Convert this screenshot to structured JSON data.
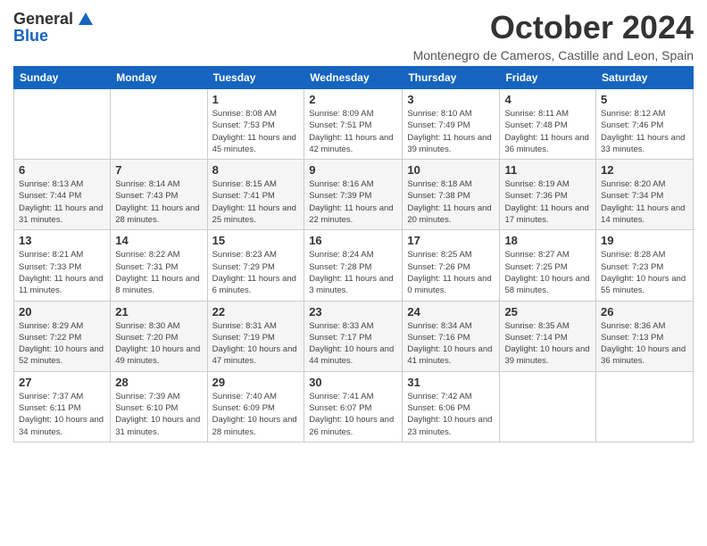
{
  "header": {
    "logo": {
      "general": "General",
      "blue": "Blue"
    },
    "title": "October 2024",
    "location": "Montenegro de Cameros, Castille and Leon, Spain"
  },
  "weekdays": [
    "Sunday",
    "Monday",
    "Tuesday",
    "Wednesday",
    "Thursday",
    "Friday",
    "Saturday"
  ],
  "weeks": [
    [
      {
        "day": "",
        "sunrise": "",
        "sunset": "",
        "daylight": ""
      },
      {
        "day": "",
        "sunrise": "",
        "sunset": "",
        "daylight": ""
      },
      {
        "day": "1",
        "sunrise": "Sunrise: 8:08 AM",
        "sunset": "Sunset: 7:53 PM",
        "daylight": "Daylight: 11 hours and 45 minutes."
      },
      {
        "day": "2",
        "sunrise": "Sunrise: 8:09 AM",
        "sunset": "Sunset: 7:51 PM",
        "daylight": "Daylight: 11 hours and 42 minutes."
      },
      {
        "day": "3",
        "sunrise": "Sunrise: 8:10 AM",
        "sunset": "Sunset: 7:49 PM",
        "daylight": "Daylight: 11 hours and 39 minutes."
      },
      {
        "day": "4",
        "sunrise": "Sunrise: 8:11 AM",
        "sunset": "Sunset: 7:48 PM",
        "daylight": "Daylight: 11 hours and 36 minutes."
      },
      {
        "day": "5",
        "sunrise": "Sunrise: 8:12 AM",
        "sunset": "Sunset: 7:46 PM",
        "daylight": "Daylight: 11 hours and 33 minutes."
      }
    ],
    [
      {
        "day": "6",
        "sunrise": "Sunrise: 8:13 AM",
        "sunset": "Sunset: 7:44 PM",
        "daylight": "Daylight: 11 hours and 31 minutes."
      },
      {
        "day": "7",
        "sunrise": "Sunrise: 8:14 AM",
        "sunset": "Sunset: 7:43 PM",
        "daylight": "Daylight: 11 hours and 28 minutes."
      },
      {
        "day": "8",
        "sunrise": "Sunrise: 8:15 AM",
        "sunset": "Sunset: 7:41 PM",
        "daylight": "Daylight: 11 hours and 25 minutes."
      },
      {
        "day": "9",
        "sunrise": "Sunrise: 8:16 AM",
        "sunset": "Sunset: 7:39 PM",
        "daylight": "Daylight: 11 hours and 22 minutes."
      },
      {
        "day": "10",
        "sunrise": "Sunrise: 8:18 AM",
        "sunset": "Sunset: 7:38 PM",
        "daylight": "Daylight: 11 hours and 20 minutes."
      },
      {
        "day": "11",
        "sunrise": "Sunrise: 8:19 AM",
        "sunset": "Sunset: 7:36 PM",
        "daylight": "Daylight: 11 hours and 17 minutes."
      },
      {
        "day": "12",
        "sunrise": "Sunrise: 8:20 AM",
        "sunset": "Sunset: 7:34 PM",
        "daylight": "Daylight: 11 hours and 14 minutes."
      }
    ],
    [
      {
        "day": "13",
        "sunrise": "Sunrise: 8:21 AM",
        "sunset": "Sunset: 7:33 PM",
        "daylight": "Daylight: 11 hours and 11 minutes."
      },
      {
        "day": "14",
        "sunrise": "Sunrise: 8:22 AM",
        "sunset": "Sunset: 7:31 PM",
        "daylight": "Daylight: 11 hours and 8 minutes."
      },
      {
        "day": "15",
        "sunrise": "Sunrise: 8:23 AM",
        "sunset": "Sunset: 7:29 PM",
        "daylight": "Daylight: 11 hours and 6 minutes."
      },
      {
        "day": "16",
        "sunrise": "Sunrise: 8:24 AM",
        "sunset": "Sunset: 7:28 PM",
        "daylight": "Daylight: 11 hours and 3 minutes."
      },
      {
        "day": "17",
        "sunrise": "Sunrise: 8:25 AM",
        "sunset": "Sunset: 7:26 PM",
        "daylight": "Daylight: 11 hours and 0 minutes."
      },
      {
        "day": "18",
        "sunrise": "Sunrise: 8:27 AM",
        "sunset": "Sunset: 7:25 PM",
        "daylight": "Daylight: 10 hours and 58 minutes."
      },
      {
        "day": "19",
        "sunrise": "Sunrise: 8:28 AM",
        "sunset": "Sunset: 7:23 PM",
        "daylight": "Daylight: 10 hours and 55 minutes."
      }
    ],
    [
      {
        "day": "20",
        "sunrise": "Sunrise: 8:29 AM",
        "sunset": "Sunset: 7:22 PM",
        "daylight": "Daylight: 10 hours and 52 minutes."
      },
      {
        "day": "21",
        "sunrise": "Sunrise: 8:30 AM",
        "sunset": "Sunset: 7:20 PM",
        "daylight": "Daylight: 10 hours and 49 minutes."
      },
      {
        "day": "22",
        "sunrise": "Sunrise: 8:31 AM",
        "sunset": "Sunset: 7:19 PM",
        "daylight": "Daylight: 10 hours and 47 minutes."
      },
      {
        "day": "23",
        "sunrise": "Sunrise: 8:33 AM",
        "sunset": "Sunset: 7:17 PM",
        "daylight": "Daylight: 10 hours and 44 minutes."
      },
      {
        "day": "24",
        "sunrise": "Sunrise: 8:34 AM",
        "sunset": "Sunset: 7:16 PM",
        "daylight": "Daylight: 10 hours and 41 minutes."
      },
      {
        "day": "25",
        "sunrise": "Sunrise: 8:35 AM",
        "sunset": "Sunset: 7:14 PM",
        "daylight": "Daylight: 10 hours and 39 minutes."
      },
      {
        "day": "26",
        "sunrise": "Sunrise: 8:36 AM",
        "sunset": "Sunset: 7:13 PM",
        "daylight": "Daylight: 10 hours and 36 minutes."
      }
    ],
    [
      {
        "day": "27",
        "sunrise": "Sunrise: 7:37 AM",
        "sunset": "Sunset: 6:11 PM",
        "daylight": "Daylight: 10 hours and 34 minutes."
      },
      {
        "day": "28",
        "sunrise": "Sunrise: 7:39 AM",
        "sunset": "Sunset: 6:10 PM",
        "daylight": "Daylight: 10 hours and 31 minutes."
      },
      {
        "day": "29",
        "sunrise": "Sunrise: 7:40 AM",
        "sunset": "Sunset: 6:09 PM",
        "daylight": "Daylight: 10 hours and 28 minutes."
      },
      {
        "day": "30",
        "sunrise": "Sunrise: 7:41 AM",
        "sunset": "Sunset: 6:07 PM",
        "daylight": "Daylight: 10 hours and 26 minutes."
      },
      {
        "day": "31",
        "sunrise": "Sunrise: 7:42 AM",
        "sunset": "Sunset: 6:06 PM",
        "daylight": "Daylight: 10 hours and 23 minutes."
      },
      {
        "day": "",
        "sunrise": "",
        "sunset": "",
        "daylight": ""
      },
      {
        "day": "",
        "sunrise": "",
        "sunset": "",
        "daylight": ""
      }
    ]
  ]
}
